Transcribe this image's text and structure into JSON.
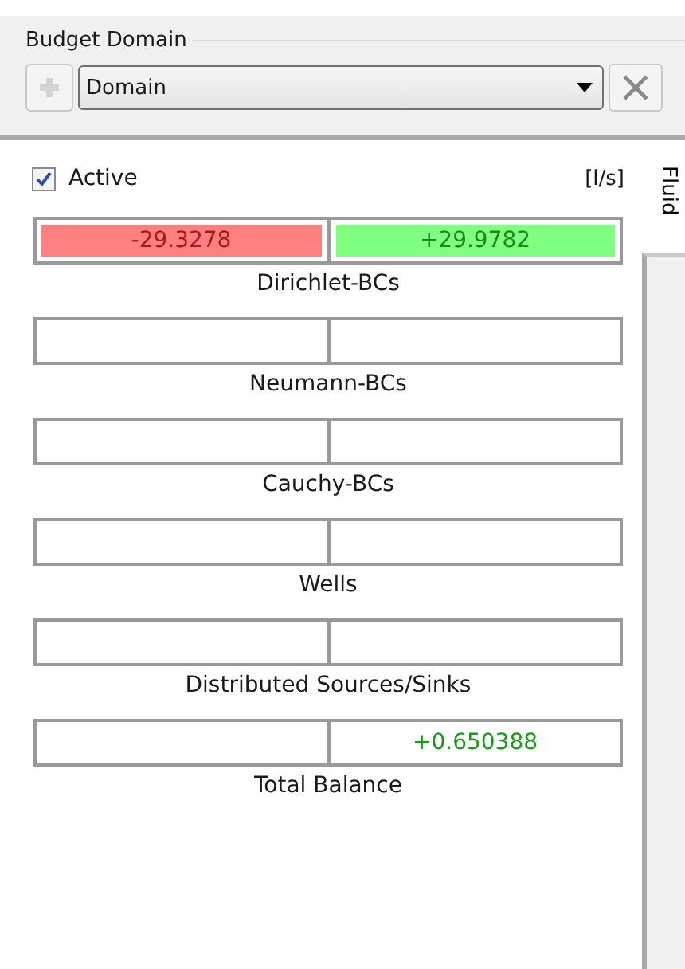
{
  "group": {
    "title": "Budget Domain"
  },
  "domain_select": {
    "value": "Domain"
  },
  "active": {
    "label": "Active",
    "checked": true
  },
  "unit": "[l/s]",
  "side_tab": {
    "label": "Fluid",
    "selected": true
  },
  "budgets": [
    {
      "label": "Dirichlet-BCs",
      "cells": [
        {
          "kind": "deficit",
          "value": "-29.3278"
        },
        {
          "kind": "surplus",
          "value": "+29.9782"
        }
      ]
    },
    {
      "label": "Neumann-BCs",
      "cells": [
        {
          "kind": "blank"
        },
        {
          "kind": "blank"
        }
      ]
    },
    {
      "label": "Cauchy-BCs",
      "cells": [
        {
          "kind": "blank"
        },
        {
          "kind": "blank"
        }
      ]
    },
    {
      "label": "Wells",
      "cells": [
        {
          "kind": "blank"
        },
        {
          "kind": "blank"
        }
      ]
    },
    {
      "label": "Distributed Sources/Sinks",
      "cells": [
        {
          "kind": "blank"
        },
        {
          "kind": "blank"
        }
      ]
    },
    {
      "label": "Total Balance",
      "cells": [
        {
          "kind": "blank"
        },
        {
          "kind": "gain",
          "value": "+0.650388"
        }
      ]
    }
  ]
}
